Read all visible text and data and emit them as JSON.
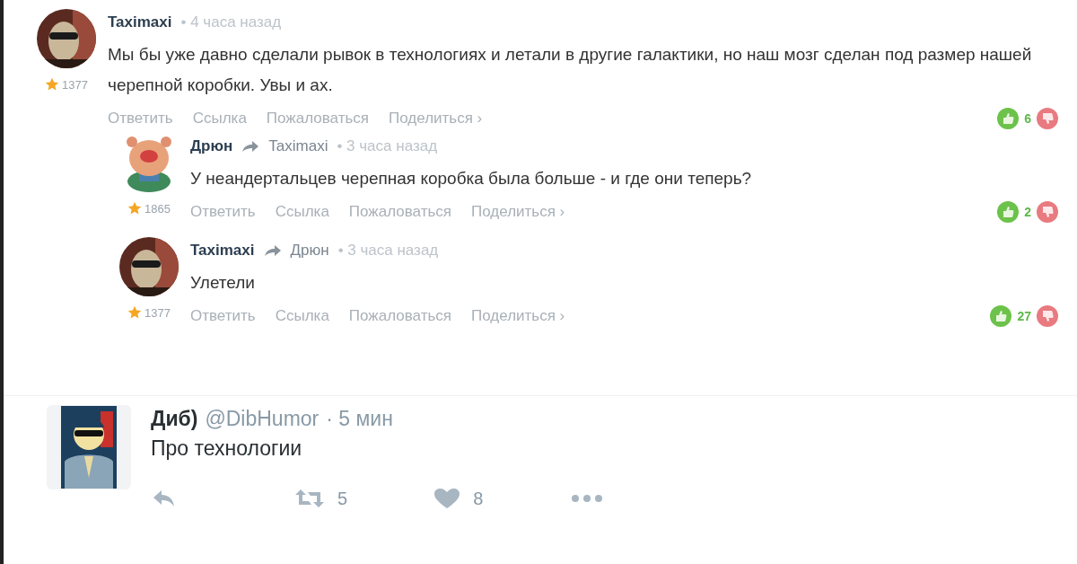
{
  "comments": [
    {
      "author": "Taximaxi",
      "time": "• 4 часа назад",
      "rating": "1377",
      "text": "Мы бы уже давно сделали рывок в технологиях и летали в другие галактики, но наш мозг сделан под размер нашей черепной коробки. Увы и ах.",
      "actions": [
        "Ответить",
        "Ссылка",
        "Пожаловаться",
        "Поделиться ›"
      ],
      "likes": "6",
      "children": [
        {
          "author": "Дрюн",
          "reply_to": "Taximaxi",
          "time": "• 3 часа назад",
          "rating": "1865",
          "text": "У неандертальцев черепная коробка была больше - и где они теперь?",
          "actions": [
            "Ответить",
            "Ссылка",
            "Пожаловаться",
            "Поделиться ›"
          ],
          "likes": "2"
        },
        {
          "author": "Taximaxi",
          "reply_to": "Дрюн",
          "time": "• 3 часа назад",
          "rating": "1377",
          "text": "Улетели",
          "actions": [
            "Ответить",
            "Ссылка",
            "Пожаловаться",
            "Поделиться ›"
          ],
          "likes": "27"
        }
      ]
    }
  ],
  "tweet": {
    "name": "Диб)",
    "handle": "@DibHumor",
    "time": "· 5 мин",
    "text": "Про технологии",
    "retweets": "5",
    "likes": "8"
  }
}
